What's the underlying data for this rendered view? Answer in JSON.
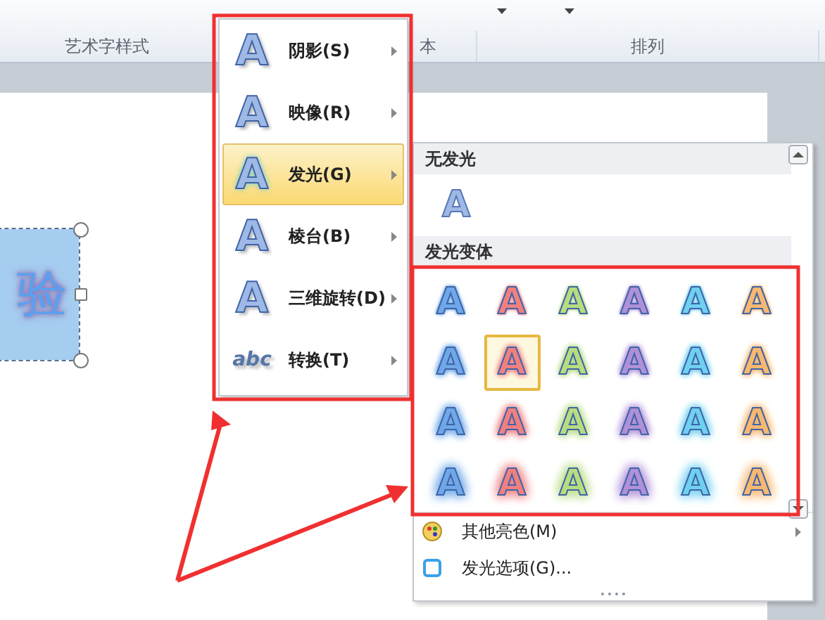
{
  "ribbon": {
    "groups": [
      {
        "label": "艺术字样式"
      },
      {
        "label": "本"
      },
      {
        "label": "排列"
      }
    ]
  },
  "canvas": {
    "text_box": {
      "text": "验",
      "selected": true
    }
  },
  "effects_menu": {
    "items": [
      {
        "icon_glyph": "A",
        "label": "阴影(S)",
        "selected": false,
        "has_submenu": true
      },
      {
        "icon_glyph": "A",
        "label": "映像(R)",
        "selected": false,
        "has_submenu": true
      },
      {
        "icon_glyph": "A",
        "label": "发光(G)",
        "selected": true,
        "has_submenu": true
      },
      {
        "icon_glyph": "A",
        "label": "棱台(B)",
        "selected": false,
        "has_submenu": true
      },
      {
        "icon_glyph": "A",
        "label": "三维旋转(D)",
        "selected": false,
        "has_submenu": true
      },
      {
        "icon_glyph": "abc",
        "label": "转换(T)",
        "selected": false,
        "has_submenu": true
      }
    ]
  },
  "glow_gallery": {
    "no_glow": {
      "header": "无发光",
      "glyph": "A"
    },
    "variants_header": "发光变体",
    "variant_rows": [
      [
        {
          "glyph": "A",
          "color": "#6fa8e8",
          "selected": false
        },
        {
          "glyph": "A",
          "color": "#f08080",
          "selected": false
        },
        {
          "glyph": "A",
          "color": "#b8dc80",
          "selected": false
        },
        {
          "glyph": "A",
          "color": "#b090d8",
          "selected": false
        },
        {
          "glyph": "A",
          "color": "#70d0f0",
          "selected": false
        },
        {
          "glyph": "A",
          "color": "#f8b870",
          "selected": false
        }
      ],
      [
        {
          "glyph": "A",
          "color": "#6fa8e8",
          "selected": false
        },
        {
          "glyph": "A",
          "color": "#f08080",
          "selected": true
        },
        {
          "glyph": "A",
          "color": "#b8dc80",
          "selected": false
        },
        {
          "glyph": "A",
          "color": "#b090d8",
          "selected": false
        },
        {
          "glyph": "A",
          "color": "#70d0f0",
          "selected": false
        },
        {
          "glyph": "A",
          "color": "#f8b870",
          "selected": false
        }
      ],
      [
        {
          "glyph": "A",
          "color": "#6fa8e8",
          "selected": false
        },
        {
          "glyph": "A",
          "color": "#f08080",
          "selected": false
        },
        {
          "glyph": "A",
          "color": "#b8dc80",
          "selected": false
        },
        {
          "glyph": "A",
          "color": "#b090d8",
          "selected": false
        },
        {
          "glyph": "A",
          "color": "#70d0f0",
          "selected": false
        },
        {
          "glyph": "A",
          "color": "#f8b870",
          "selected": false
        }
      ],
      [
        {
          "glyph": "A",
          "color": "#6fa8e8",
          "selected": false
        },
        {
          "glyph": "A",
          "color": "#f08080",
          "selected": false
        },
        {
          "glyph": "A",
          "color": "#b8dc80",
          "selected": false
        },
        {
          "glyph": "A",
          "color": "#b090d8",
          "selected": false
        },
        {
          "glyph": "A",
          "color": "#70d0f0",
          "selected": false
        },
        {
          "glyph": "A",
          "color": "#f8b870",
          "selected": false
        }
      ]
    ],
    "commands": [
      {
        "kind": "colors",
        "label": "其他亮色(M)",
        "has_submenu": true
      },
      {
        "kind": "options",
        "label": "发光选项(G)...",
        "has_submenu": false
      }
    ]
  }
}
